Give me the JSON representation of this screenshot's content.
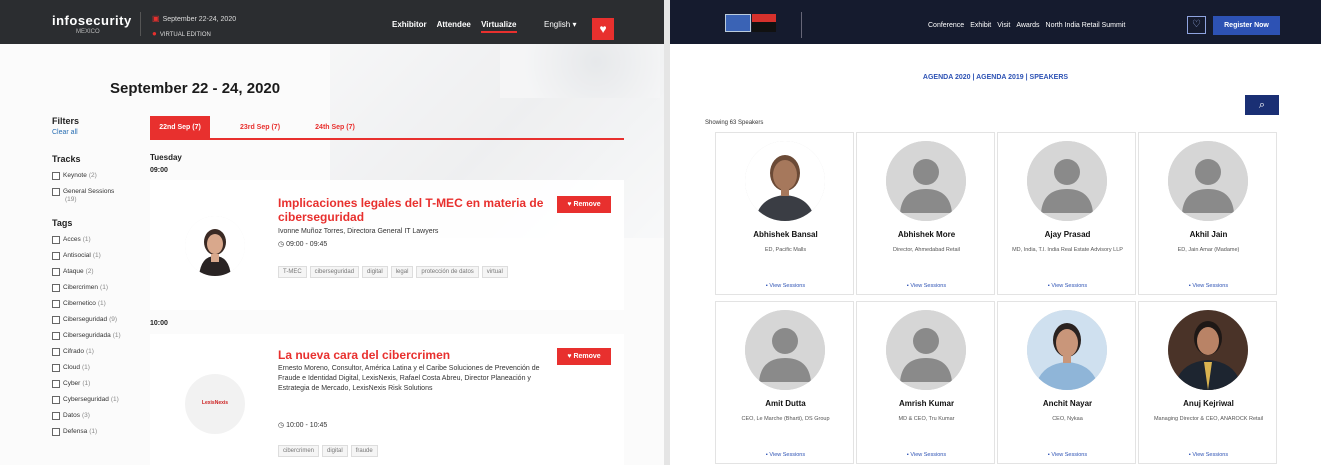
{
  "left": {
    "nav": {
      "logo": "infosecurity",
      "logo_sub": "MEXICO",
      "date": "September 22-24, 2020",
      "edition": "VIRTUAL EDITION",
      "links": [
        "Exhibitor",
        "Attendee",
        "Virtualize"
      ],
      "language": "English ▾"
    },
    "title": "September 22 - 24, 2020",
    "filters": {
      "heading": "Filters",
      "clear": "Clear all",
      "tracks_heading": "Tracks",
      "tracks": [
        {
          "label": "Keynote",
          "count": "(2)"
        },
        {
          "label": "General Sessions",
          "count": "(19)"
        }
      ],
      "tags_heading": "Tags",
      "tags": [
        {
          "label": "Acces",
          "count": "(1)"
        },
        {
          "label": "Antisocial",
          "count": "(1)"
        },
        {
          "label": "Ataque",
          "count": "(2)"
        },
        {
          "label": "Cibercrimen",
          "count": "(1)"
        },
        {
          "label": "Cibernetico",
          "count": "(1)"
        },
        {
          "label": "Ciberseguridad",
          "count": "(9)"
        },
        {
          "label": "Ciberseguridada",
          "count": "(1)"
        },
        {
          "label": "Cifrado",
          "count": "(1)"
        },
        {
          "label": "Cloud",
          "count": "(1)"
        },
        {
          "label": "Cyber",
          "count": "(1)"
        },
        {
          "label": "Cyberseguridad",
          "count": "(1)"
        },
        {
          "label": "Datos",
          "count": "(3)"
        },
        {
          "label": "Defensa",
          "count": "(1)"
        }
      ]
    },
    "tabs": [
      "22nd Sep (7)",
      "23rd Sep (7)",
      "24th Sep (7)"
    ],
    "day": "Tuesday",
    "times": [
      "09:00",
      "10:00"
    ],
    "sessions": [
      {
        "title": "Implicaciones legales del T-MEC en materia de ciberseguridad",
        "desc": "Ivonne Muñoz Torres, Directora General IT Lawyers",
        "time": "09:00 - 09:45",
        "tags": [
          "T-MEC",
          "ciberseguridad",
          "digital",
          "legal",
          "protección de datos",
          "virtual"
        ],
        "remove": "Remove"
      },
      {
        "title": "La nueva cara del cibercrimen",
        "desc": "Ernesto Moreno, Consultor, América Latina y el Caribe Soluciones de Prevención de Fraude e Identidad Digital, LexisNexis, Rafael Costa Abreu, Director Planeación y Estrategia de Mercado, LexisNexis Risk Solutions",
        "time": "10:00 - 10:45",
        "tags": [
          "cibercrimen",
          "digital",
          "fraude"
        ],
        "remove": "Remove",
        "logo": "LexisNexis"
      }
    ]
  },
  "right": {
    "nav": {
      "links": [
        "Conference",
        "Exhibit",
        "Visit",
        "Awards",
        "North India Retail Summit"
      ],
      "register": "Register Now"
    },
    "agenda": "AGENDA 2020 | AGENDA 2019 | SPEAKERS",
    "showing": "Showing 63 Speakers",
    "view": "View Sessions",
    "speakers": [
      {
        "name": "Abhishek Bansal",
        "role": "ED, Pacific Malls"
      },
      {
        "name": "Abhishek More",
        "role": "Director, Ahmedabad Retail"
      },
      {
        "name": "Ajay Prasad",
        "role": "MD, India, T.I. India Real Estate Advisory LLP"
      },
      {
        "name": "Akhil Jain",
        "role": "ED, Jain Amar (Madame)"
      },
      {
        "name": "Amit Dutta",
        "role": "CEO, Le Marche (Bharti), DS Group"
      },
      {
        "name": "Amrish Kumar",
        "role": "MD & CEO, Tru Kumar"
      },
      {
        "name": "Anchit Nayar",
        "role": "CEO, Nykaa"
      },
      {
        "name": "Anuj Kejriwal",
        "role": "Managing Director & CEO, ANAROCK Retail"
      }
    ]
  }
}
